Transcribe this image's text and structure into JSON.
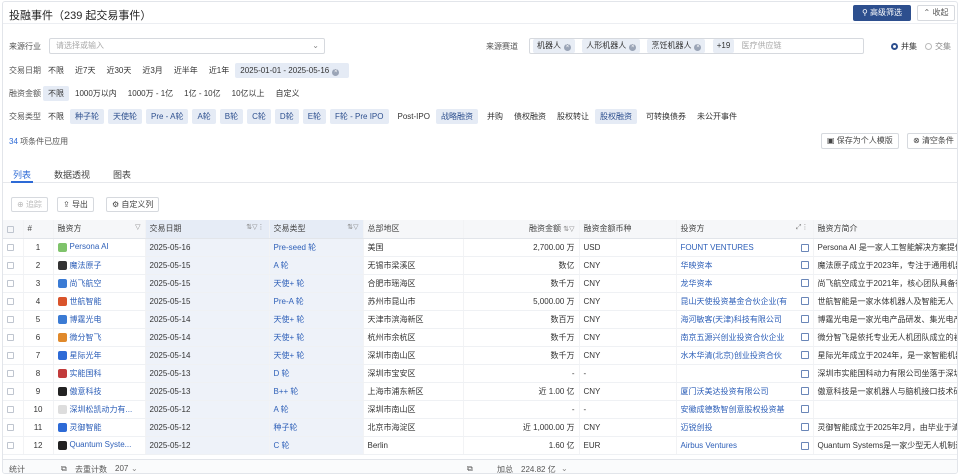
{
  "header": {
    "title": "投融事件（239 起交易事件）",
    "advanced_filter": "高级筛选",
    "collapse": "收起"
  },
  "filters": {
    "industry_label": "来源行业",
    "industry_placeholder": "请选择或输入",
    "track_label": "来源赛道",
    "track_chips": [
      "机器人",
      "人形机器人",
      "烹饪机器人"
    ],
    "track_more": "+19",
    "track_placeholder": "医疗供应链",
    "logic_options": [
      "并集",
      "交集"
    ],
    "date_label": "交易日期",
    "date_options": [
      "不限",
      "近7天",
      "近30天",
      "近3月",
      "近半年",
      "近1年"
    ],
    "date_range": "2025-01-01 - 2025-05-16",
    "amount_label": "融资金额",
    "amount_options": [
      "不限",
      "1000万以内",
      "1000万 - 1亿",
      "1亿 - 10亿",
      "10亿以上",
      "自定义"
    ],
    "type_label": "交易类型",
    "type_options": [
      "不限",
      "种子轮",
      "天使轮",
      "Pre - A轮",
      "A轮",
      "B轮",
      "C轮",
      "D轮",
      "E轮",
      "F轮 - Pre IPO",
      "Post-IPO",
      "战略融资",
      "并购",
      "债权融资",
      "股权转让",
      "股权融资",
      "可转换债券",
      "未公开事件"
    ],
    "applied_count": "34",
    "applied_text": "项条件已应用",
    "save_template": "保存为个人模版",
    "clear": "清空条件"
  },
  "tabs": [
    "列表",
    "数据透视",
    "图表"
  ],
  "toolbar": {
    "track": "追踪",
    "export": "导出",
    "custom_cols": "自定义列"
  },
  "table": {
    "columns": [
      "#",
      "融资方",
      "交易日期",
      "交易类型",
      "总部地区",
      "融资金额",
      "融资金额币种",
      "投资方",
      "融资方简介"
    ],
    "rows": [
      {
        "n": "1",
        "name": "Persona AI",
        "date": "2025-05-16",
        "type": "Pre-seed 轮",
        "region": "美国",
        "amount": "2,700.00 万",
        "cur": "USD",
        "investor": "FOUNT VENTURES",
        "desc": "Persona AI 是一家人工智能解决方案提供商",
        "color": "#7fc36b"
      },
      {
        "n": "2",
        "name": "魔法原子",
        "date": "2025-05-15",
        "type": "A 轮",
        "region": "无锡市梁溪区",
        "amount": "数亿",
        "cur": "CNY",
        "investor": "华映资本",
        "desc": "魔法原子成立于2023年，专注于通用机器人",
        "color": "#333"
      },
      {
        "n": "3",
        "name": "尚飞航空",
        "date": "2025-05-15",
        "type": "天使+ 轮",
        "region": "合肥市瑶海区",
        "amount": "数千万",
        "cur": "CNY",
        "investor": "龙华资本",
        "desc": "尚飞航空成立于2021年，核心团队具备行业",
        "color": "#3b7bd4"
      },
      {
        "n": "4",
        "name": "世航智能",
        "date": "2025-05-15",
        "type": "Pre-A 轮",
        "region": "苏州市昆山市",
        "amount": "5,000.00 万",
        "cur": "CNY",
        "investor": "昆山天使投资基金合伙企业(有",
        "desc": "世航智能是一家水体机器人及智能无人",
        "color": "#d9542b"
      },
      {
        "n": "5",
        "name": "博霆光电",
        "date": "2025-05-14",
        "type": "天使+ 轮",
        "region": "天津市滨海新区",
        "amount": "数百万",
        "cur": "CNY",
        "investor": "海河敏客(天津)科技有限公司",
        "desc": "博霆光电是一家光电产品研发、集光电产",
        "color": "#3b7bd4"
      },
      {
        "n": "6",
        "name": "微分智飞",
        "date": "2025-05-14",
        "type": "天使+ 轮",
        "region": "杭州市余杭区",
        "amount": "数千万",
        "cur": "CNY",
        "investor": "南京五源兴创业投资合伙企业",
        "desc": "微分智飞是依托专业无人机团队成立的初创",
        "color": "#e0892b"
      },
      {
        "n": "7",
        "name": "星际光年",
        "date": "2025-05-14",
        "type": "天使+ 轮",
        "region": "深圳市南山区",
        "amount": "数千万",
        "cur": "CNY",
        "investor": "水木华清(北京)创业投资合伙",
        "desc": "星际光年成立于2024年，是一家智能机器人",
        "color": "#2d6ad6"
      },
      {
        "n": "8",
        "name": "实能国科",
        "date": "2025-05-13",
        "type": "D 轮",
        "region": "深圳市宝安区",
        "amount": "-",
        "cur": "-",
        "investor": "",
        "desc": "深圳市实能国科动力有限公司坐落于深圳市",
        "color": "#c23b3b"
      },
      {
        "n": "9",
        "name": "傲意科技",
        "date": "2025-05-13",
        "type": "B++ 轮",
        "region": "上海市浦东新区",
        "amount": "近 1.00 亿",
        "cur": "CNY",
        "investor": "厦门沃美达投资有限公司",
        "desc": "傲意科技是一家机器人与脑机接口技术研发",
        "color": "#222"
      },
      {
        "n": "10",
        "name": "深圳松凯动力有...",
        "date": "2025-05-12",
        "type": "A 轮",
        "region": "深圳市南山区",
        "amount": "-",
        "cur": "-",
        "investor": "安徽成德数智创意股权投资基",
        "desc": "",
        "color": "#ddd"
      },
      {
        "n": "11",
        "name": "灵御智能",
        "date": "2025-05-12",
        "type": "种子轮",
        "region": "北京市海淀区",
        "amount": "近 1,000.00 万",
        "cur": "CNY",
        "investor": "迈锐创投",
        "desc": "灵御智能成立于2025年2月，由毕业于清华",
        "color": "#2d6ad6"
      },
      {
        "n": "12",
        "name": "Quantum Syste...",
        "date": "2025-05-12",
        "type": "C 轮",
        "region": "Berlin",
        "amount": "1.60 亿",
        "cur": "EUR",
        "investor": "Airbus Ventures",
        "desc": "Quantum Systems是一家少型无人机制造",
        "color": "#222"
      }
    ]
  },
  "footer": {
    "stat_label": "统计",
    "count_label": "去重计数",
    "count_value": "207",
    "sum_label": "加总",
    "sum_value": "224.82 亿"
  }
}
